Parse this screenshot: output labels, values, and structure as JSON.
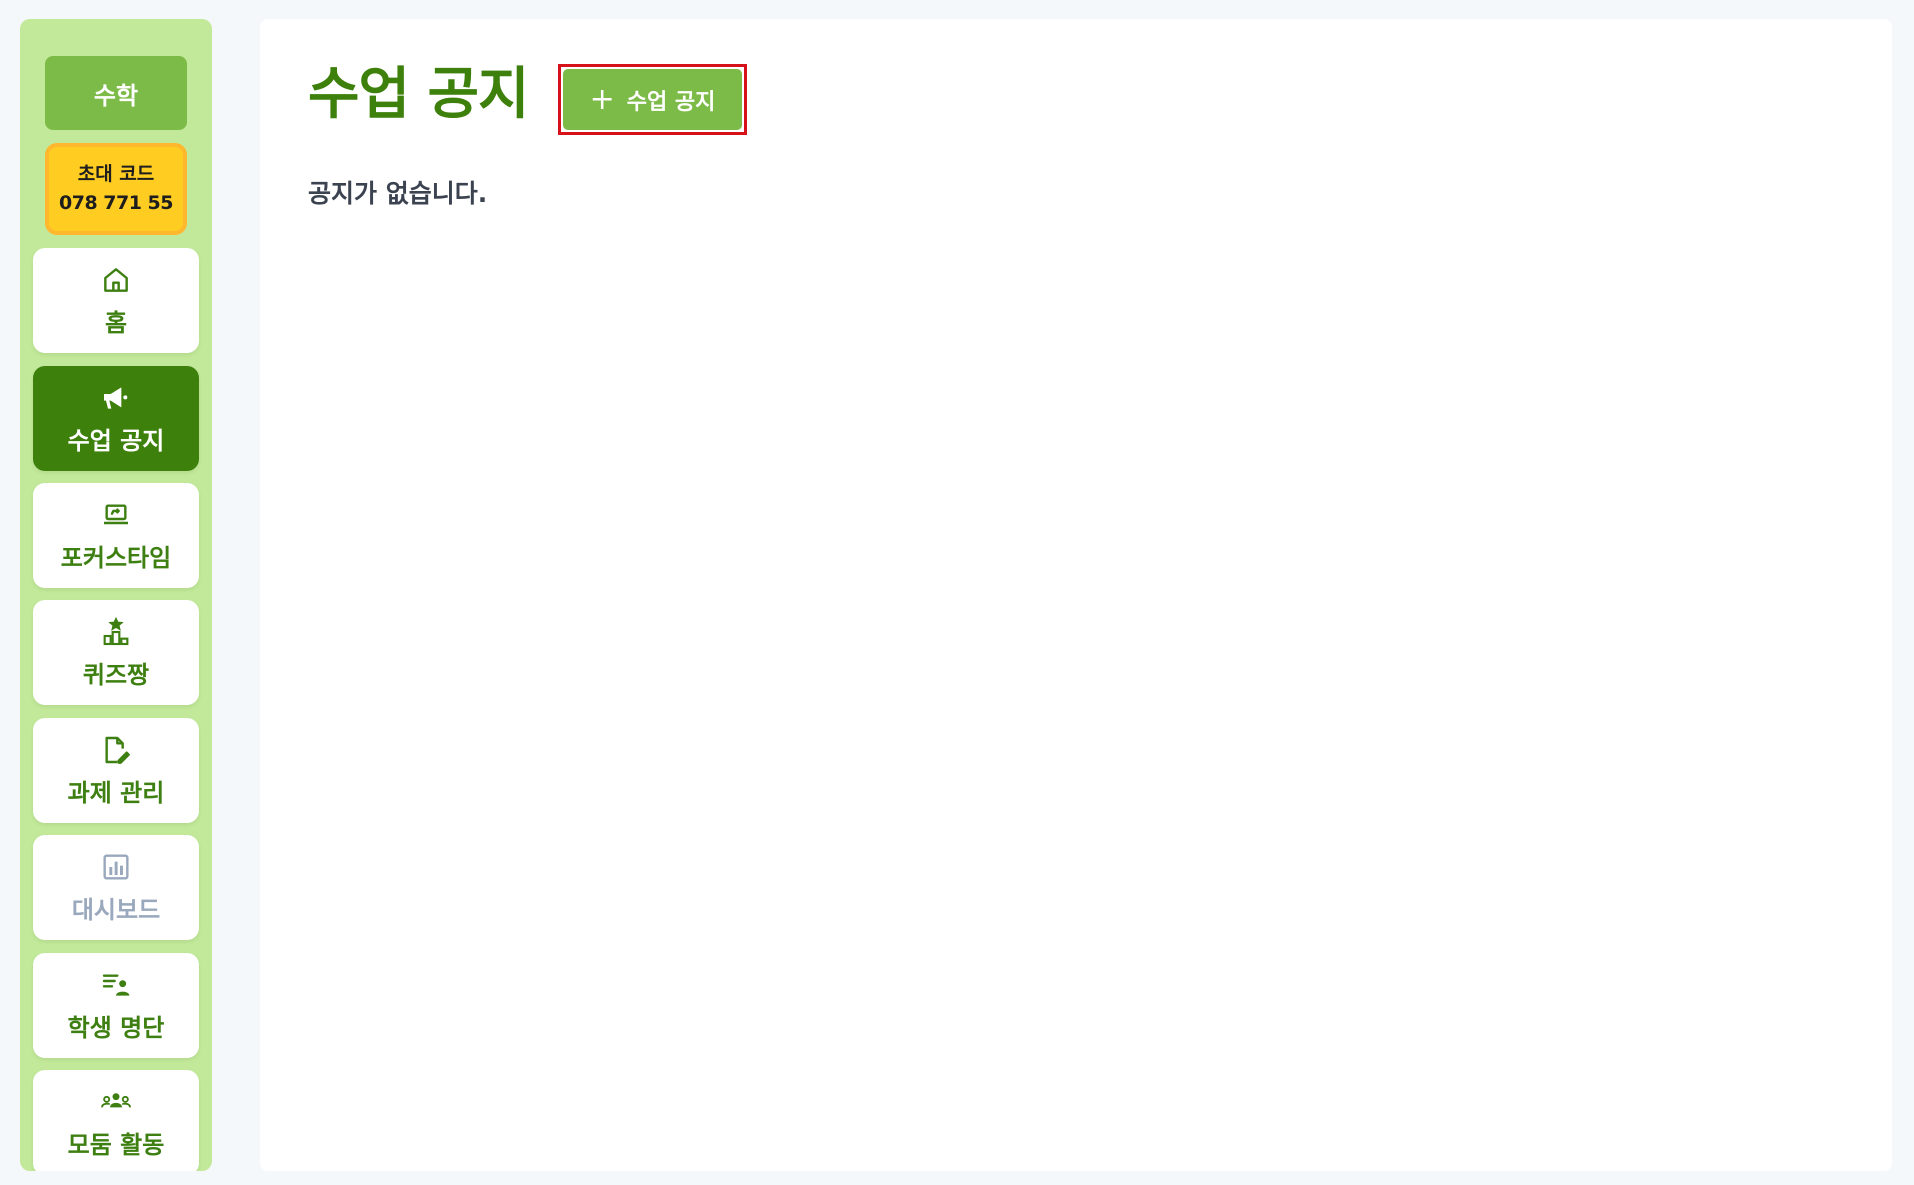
{
  "sidebar": {
    "class_name": "수학",
    "invite_label": "초대 코드",
    "invite_code": "078 771 55",
    "items": [
      {
        "label": "홈",
        "icon": "home-icon"
      },
      {
        "label": "수업 공지",
        "icon": "megaphone-icon"
      },
      {
        "label": "포커스타임",
        "icon": "laptop-icon"
      },
      {
        "label": "퀴즈짱",
        "icon": "podium-icon"
      },
      {
        "label": "과제 관리",
        "icon": "edit-document-icon"
      },
      {
        "label": "대시보드",
        "icon": "chart-icon"
      },
      {
        "label": "학생 명단",
        "icon": "student-list-icon"
      },
      {
        "label": "모둠 활동",
        "icon": "group-icon"
      }
    ]
  },
  "main": {
    "title": "수업 공지",
    "add_button_label": "수업 공지",
    "empty_message": "공지가 없습니다."
  },
  "colors": {
    "brand_dark_green": "#3d800c",
    "brand_green": "#7cbb48",
    "sidebar_bg": "#c2e999",
    "invite_yellow": "#ffcc22",
    "highlight_red": "#d6111a"
  }
}
